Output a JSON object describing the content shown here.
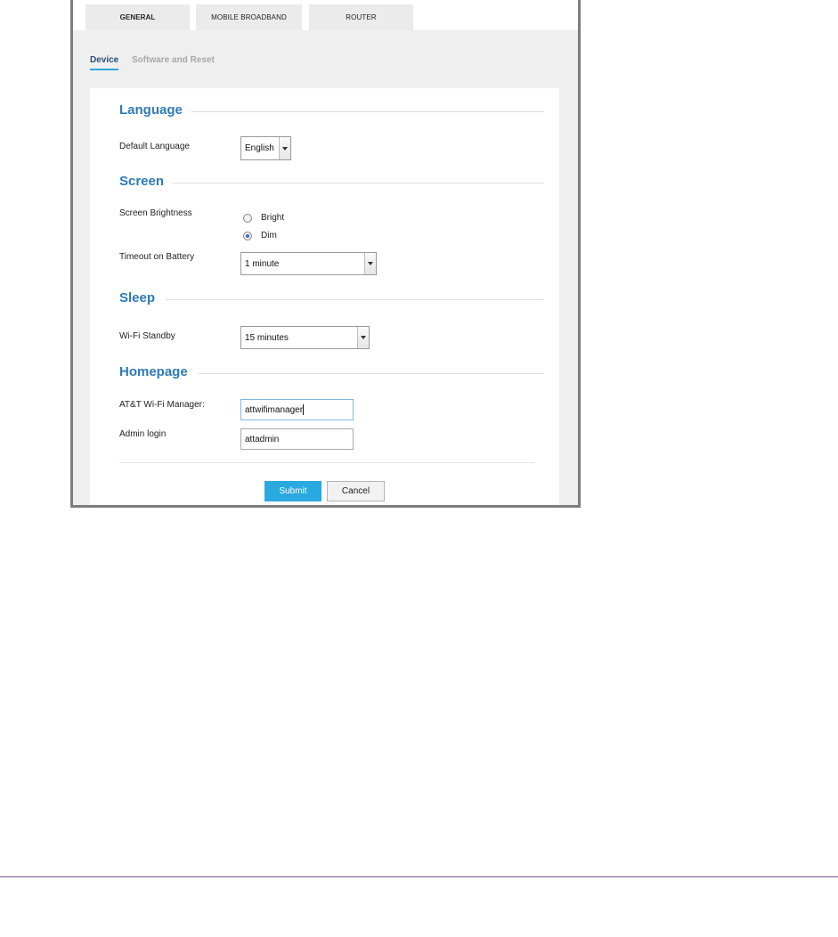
{
  "tabs": [
    {
      "label": "GENERAL",
      "active": true
    },
    {
      "label": "MOBILE BROADBAND",
      "active": false
    },
    {
      "label": "ROUTER",
      "active": false
    }
  ],
  "subnav": {
    "active": "Device",
    "inactive": "Software and Reset"
  },
  "sections": {
    "language": {
      "title": "Language",
      "default_language_label": "Default Language",
      "default_language_value": "English"
    },
    "screen": {
      "title": "Screen",
      "brightness_label": "Screen Brightness",
      "brightness_options": [
        {
          "label": "Bright",
          "checked": false
        },
        {
          "label": "Dim",
          "checked": true
        }
      ],
      "timeout_label": "Timeout on Battery",
      "timeout_value": "1 minute"
    },
    "sleep": {
      "title": "Sleep",
      "wifi_standby_label": "Wi-Fi Standby",
      "wifi_standby_value": "15 minutes"
    },
    "homepage": {
      "title": "Homepage",
      "manager_label": "AT&T Wi-Fi Manager:",
      "manager_value": "attwifimanager",
      "admin_label": "Admin login",
      "admin_value": "attadmin"
    }
  },
  "buttons": {
    "submit": "Submit",
    "cancel": "Cancel"
  },
  "colors": {
    "accent": "#2aa9e0",
    "section_title": "#2d7ab8"
  }
}
